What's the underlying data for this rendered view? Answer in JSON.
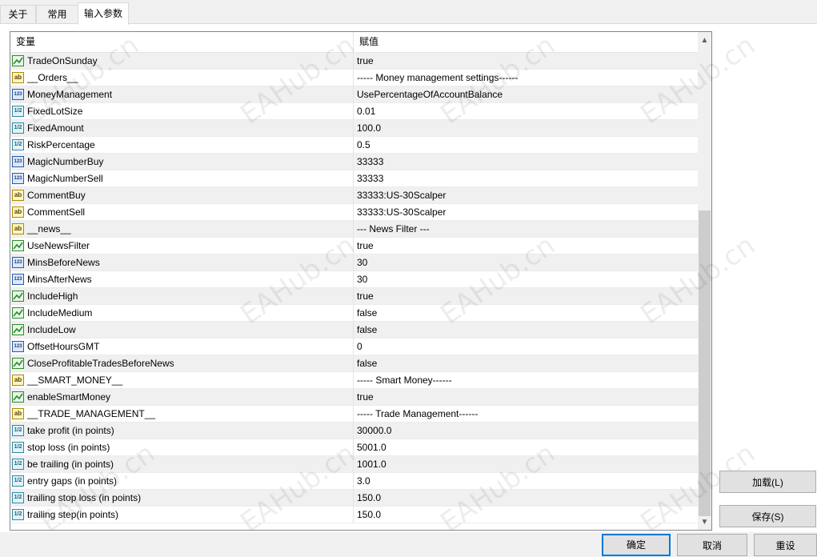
{
  "tabs": [
    {
      "label": "关于"
    },
    {
      "label": "常用"
    },
    {
      "label": "输入参数"
    }
  ],
  "list": {
    "col_variable": "变量",
    "col_value": "赋值",
    "rows": [
      {
        "type": "bool",
        "icon": "bool-icon",
        "name": "TradeOnSunday",
        "value": "true"
      },
      {
        "type": "string",
        "icon": "string-icon",
        "name": "__Orders__",
        "value": "----- Money management settings------"
      },
      {
        "type": "int",
        "icon": "int-icon",
        "name": "MoneyManagement",
        "value": "UsePercentageOfAccountBalance"
      },
      {
        "type": "double",
        "icon": "double-icon",
        "name": "FixedLotSize",
        "value": "0.01"
      },
      {
        "type": "double",
        "icon": "double-icon",
        "name": "FixedAmount",
        "value": "100.0"
      },
      {
        "type": "double",
        "icon": "double-icon",
        "name": "RiskPercentage",
        "value": "0.5"
      },
      {
        "type": "int",
        "icon": "int-icon",
        "name": "MagicNumberBuy",
        "value": "33333"
      },
      {
        "type": "int",
        "icon": "int-icon",
        "name": "MagicNumberSell",
        "value": "33333"
      },
      {
        "type": "string",
        "icon": "string-icon",
        "name": "CommentBuy",
        "value": "33333:US-30Scalper"
      },
      {
        "type": "string",
        "icon": "string-icon",
        "name": "CommentSell",
        "value": "33333:US-30Scalper"
      },
      {
        "type": "string",
        "icon": "string-icon",
        "name": "__news__",
        "value": "--- News Filter ---"
      },
      {
        "type": "bool",
        "icon": "bool-icon",
        "name": "UseNewsFilter",
        "value": "true"
      },
      {
        "type": "int",
        "icon": "int-icon",
        "name": "MinsBeforeNews",
        "value": "30"
      },
      {
        "type": "int",
        "icon": "int-icon",
        "name": "MinsAfterNews",
        "value": "30"
      },
      {
        "type": "bool",
        "icon": "bool-icon",
        "name": "IncludeHigh",
        "value": "true"
      },
      {
        "type": "bool",
        "icon": "bool-icon",
        "name": "IncludeMedium",
        "value": "false"
      },
      {
        "type": "bool",
        "icon": "bool-icon",
        "name": "IncludeLow",
        "value": "false"
      },
      {
        "type": "int",
        "icon": "int-icon",
        "name": "OffsetHoursGMT",
        "value": "0"
      },
      {
        "type": "bool",
        "icon": "bool-icon",
        "name": "CloseProfitableTradesBeforeNews",
        "value": "false"
      },
      {
        "type": "string",
        "icon": "string-icon",
        "name": "__SMART_MONEY__",
        "value": "----- Smart Money------"
      },
      {
        "type": "bool",
        "icon": "bool-icon",
        "name": "enableSmartMoney",
        "value": "true"
      },
      {
        "type": "string",
        "icon": "string-icon",
        "name": "__TRADE_MANAGEMENT__",
        "value": "----- Trade Management------"
      },
      {
        "type": "double",
        "icon": "double-icon",
        "name": "take profit (in points)",
        "value": "30000.0"
      },
      {
        "type": "double",
        "icon": "double-icon",
        "name": "stop loss (in points)",
        "value": "5001.0"
      },
      {
        "type": "double",
        "icon": "double-icon",
        "name": "be trailing (in points)",
        "value": "1001.0"
      },
      {
        "type": "double",
        "icon": "double-icon",
        "name": "entry gaps (in points)",
        "value": "3.0"
      },
      {
        "type": "double",
        "icon": "double-icon",
        "name": "trailing stop loss (in points)",
        "value": "150.0"
      },
      {
        "type": "double",
        "icon": "double-icon",
        "name": "trailing step(in points)",
        "value": "150.0"
      }
    ]
  },
  "icon_text": {
    "string": "ab",
    "int": "123",
    "double": "1/2",
    "bool": ""
  },
  "watermark": "EAHub.cn",
  "buttons": {
    "load": "加载(L)",
    "save": "保存(S)",
    "ok": "确定",
    "cancel": "取消",
    "reset": "重设"
  },
  "colors": {
    "accent": "#0078d7"
  }
}
